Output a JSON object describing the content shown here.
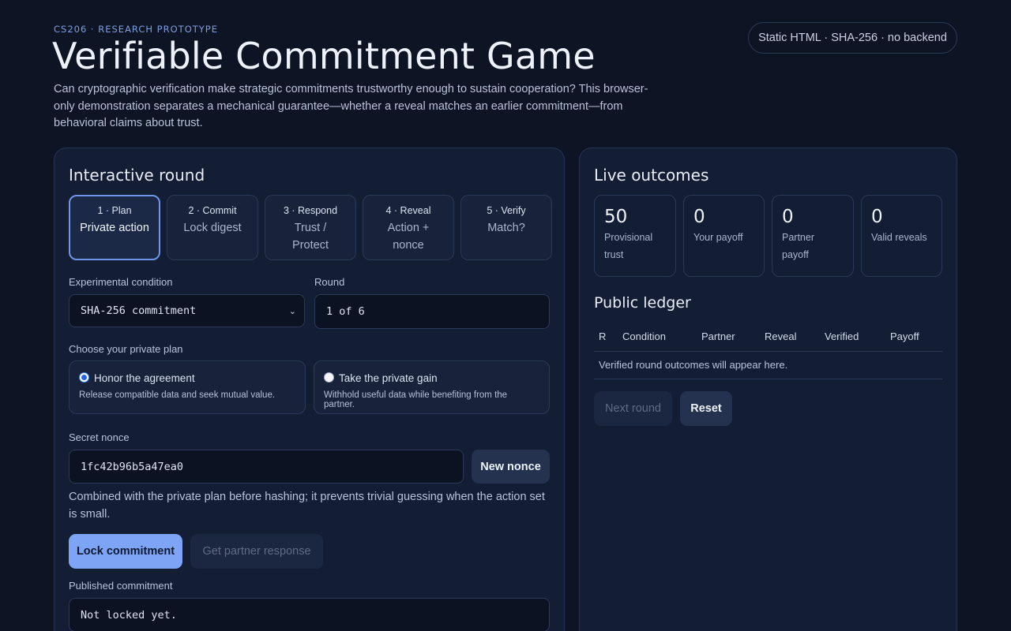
{
  "header": {
    "eyebrow": "CS206 · RESEARCH PROTOTYPE",
    "title": "Verifiable Commitment Game",
    "lede": "Can cryptographic verification make strategic commitments trustworthy enough to sustain cooperation? This browser-only demonstration separates a mechanical guarantee—whether a reveal matches an earlier commitment—from behavioral claims about trust.",
    "badge": "Static HTML · SHA-256 · no backend"
  },
  "round_panel": {
    "heading": "Interactive round",
    "steps": [
      {
        "num": "1 · Plan",
        "label": "Private action"
      },
      {
        "num": "2 · Commit",
        "label": "Lock digest"
      },
      {
        "num": "3 · Respond",
        "label": "Trust / Protect"
      },
      {
        "num": "4 · Reveal",
        "label": "Action + nonce"
      },
      {
        "num": "5 · Verify",
        "label": "Match?"
      }
    ],
    "condition_label": "Experimental condition",
    "condition_value": "SHA-256 commitment",
    "round_label": "Round",
    "round_value": "1 of 6",
    "plan_label": "Choose your private plan",
    "plans": [
      {
        "title": "Honor the agreement",
        "desc": "Release compatible data and seek mutual value.",
        "checked": true
      },
      {
        "title": "Take the private gain",
        "desc": "Withhold useful data while benefiting from the partner.",
        "checked": false
      }
    ],
    "nonce_label": "Secret nonce",
    "nonce_value": "1fc42b96b5a47ea0",
    "new_nonce_button": "New nonce",
    "nonce_note": "Combined with the private plan before hashing; it prevents trivial guessing when the action set is small.",
    "lock_button": "Lock commitment",
    "partner_button": "Get partner response",
    "published_label": "Published commitment",
    "published_value": "Not locked yet."
  },
  "outcomes_panel": {
    "heading": "Live outcomes",
    "stats": [
      {
        "value": "50",
        "label": "Provisional trust"
      },
      {
        "value": "0",
        "label": "Your payoff"
      },
      {
        "value": "0",
        "label": "Partner payoff"
      },
      {
        "value": "0",
        "label": "Valid reveals"
      }
    ],
    "ledger_heading": "Public ledger",
    "ledger_columns": [
      "R",
      "Condition",
      "Partner",
      "Reveal",
      "Verified",
      "Payoff"
    ],
    "ledger_empty": "Verified round outcomes will appear here.",
    "next_button": "Next round",
    "reset_button": "Reset"
  },
  "colors": {
    "background": "#0d1424",
    "panel": "#131d33",
    "accent": "#7ea4f5",
    "active_border": "#6f95e8"
  }
}
